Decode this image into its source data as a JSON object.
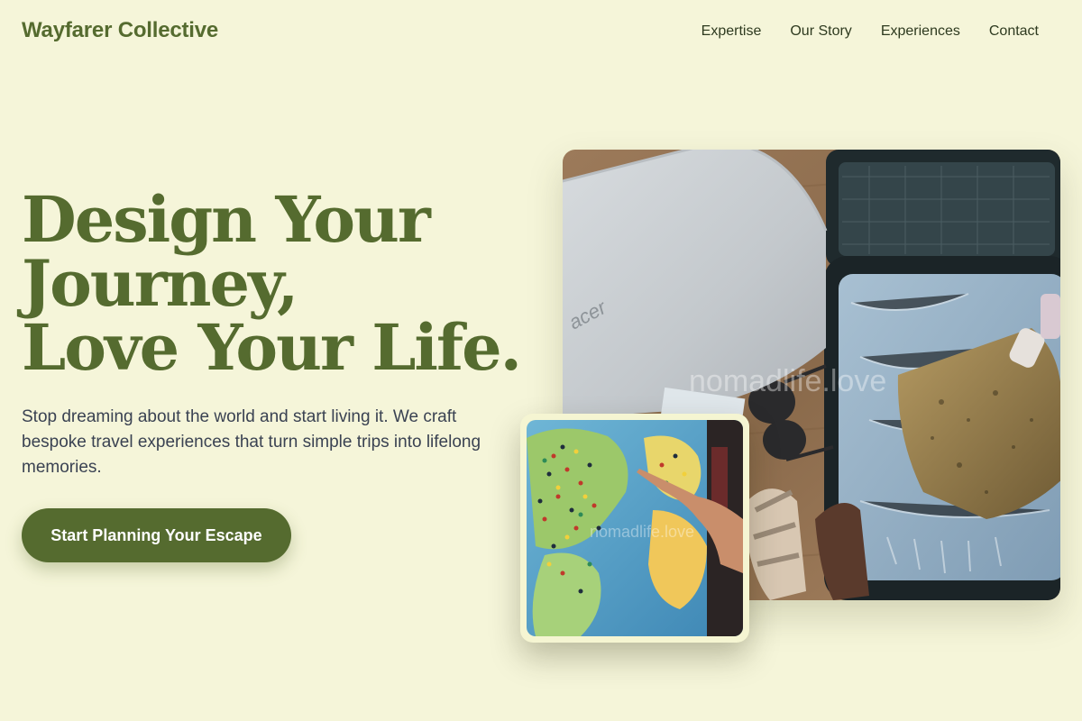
{
  "header": {
    "brand": "Wayfarer Collective",
    "nav": [
      {
        "label": "Expertise"
      },
      {
        "label": "Our Story"
      },
      {
        "label": "Experiences"
      },
      {
        "label": "Contact"
      }
    ]
  },
  "hero": {
    "title_lines": [
      "Design Your",
      "Journey,",
      "Love Your Life."
    ],
    "subtitle": "Stop dreaming about the world and start living it. We craft bespoke travel experiences that turn simple trips into lifelong memories.",
    "cta_label": "Start Planning Your Escape"
  },
  "images": {
    "main": {
      "depicts": "laptop-suitcase-flatlay",
      "laptop_logo": "acer",
      "watermark": "nomadlife.love"
    },
    "inset": {
      "depicts": "world-map-with-pins",
      "watermark": "nomadlife.love"
    }
  },
  "colors": {
    "background": "#f5f5d9",
    "accent": "#556b2f",
    "text": "#3a4252"
  }
}
